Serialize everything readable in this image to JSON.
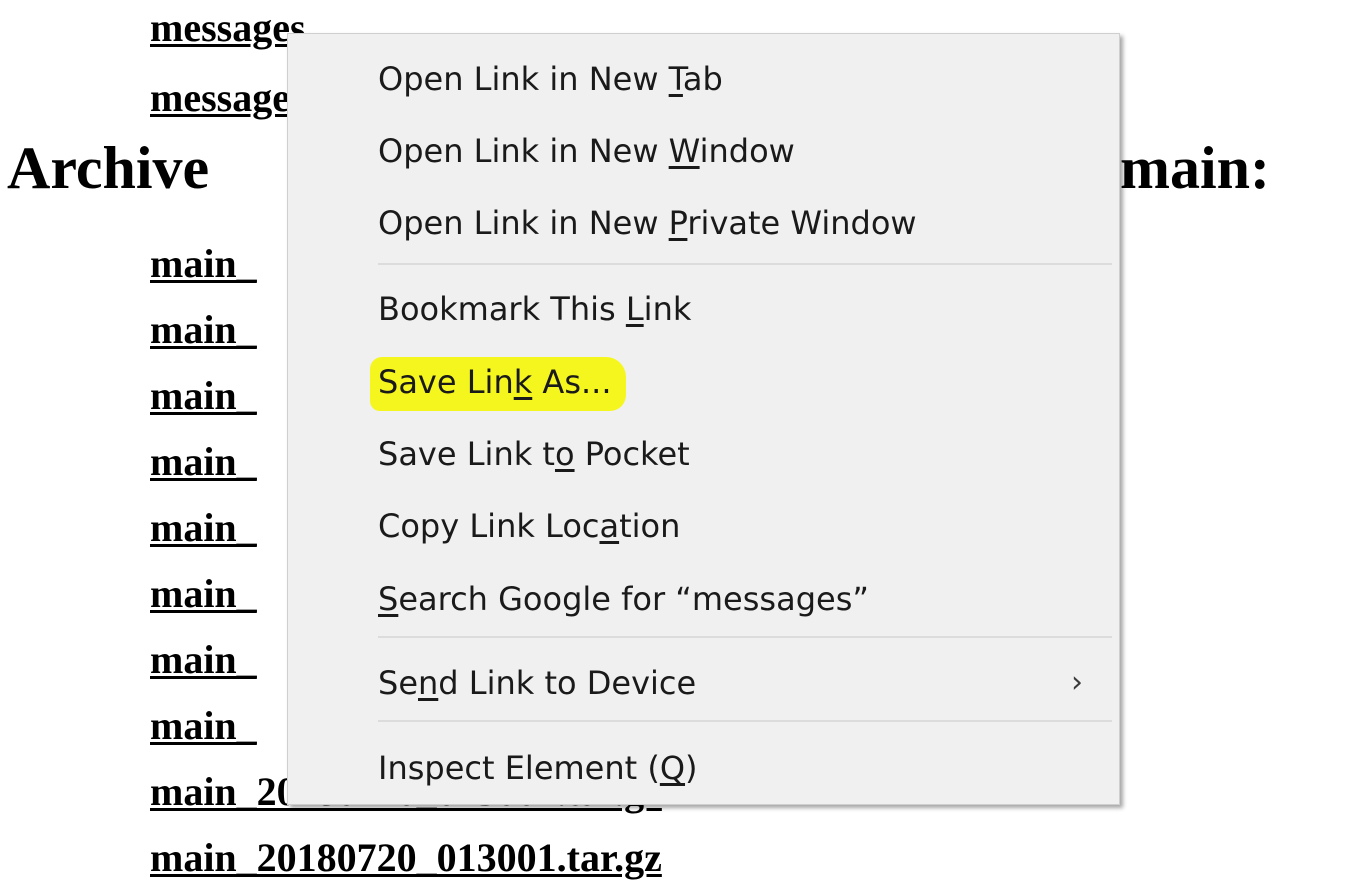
{
  "page": {
    "links_top": [
      "messages",
      "messages"
    ],
    "heading_left": "Archive",
    "heading_right": "main:",
    "main_links": [
      "main_",
      "main_",
      "main_",
      "main_",
      "main_",
      "main_",
      "main_",
      "main_",
      "main_20180720_023001.tar.gz",
      "main_20180720_013001.tar.gz"
    ]
  },
  "context_menu": {
    "items": [
      {
        "pre": "Open Link in New ",
        "key": "T",
        "post": "ab"
      },
      {
        "pre": "Open Link in New ",
        "key": "W",
        "post": "indow"
      },
      {
        "pre": "Open Link in New ",
        "key": "P",
        "post": "rivate Window"
      },
      {
        "pre": "Bookmark This ",
        "key": "L",
        "post": "ink"
      },
      {
        "pre": "Save Lin",
        "key": "k",
        "post": " As...",
        "highlight": "#f6f61f"
      },
      {
        "pre": "Save Link t",
        "key": "o",
        "post": " Pocket"
      },
      {
        "pre": "Copy Link Loc",
        "key": "a",
        "post": "tion"
      },
      {
        "pre": "",
        "key": "S",
        "post": "earch Google for “messages”"
      },
      {
        "pre": "Se",
        "key": "n",
        "post": "d Link to Device",
        "submenu_icon": "chevron-right-icon"
      },
      {
        "pre": "Inspect Element (",
        "key": "Q",
        "post": ")"
      }
    ],
    "submenu_glyph": "›"
  }
}
